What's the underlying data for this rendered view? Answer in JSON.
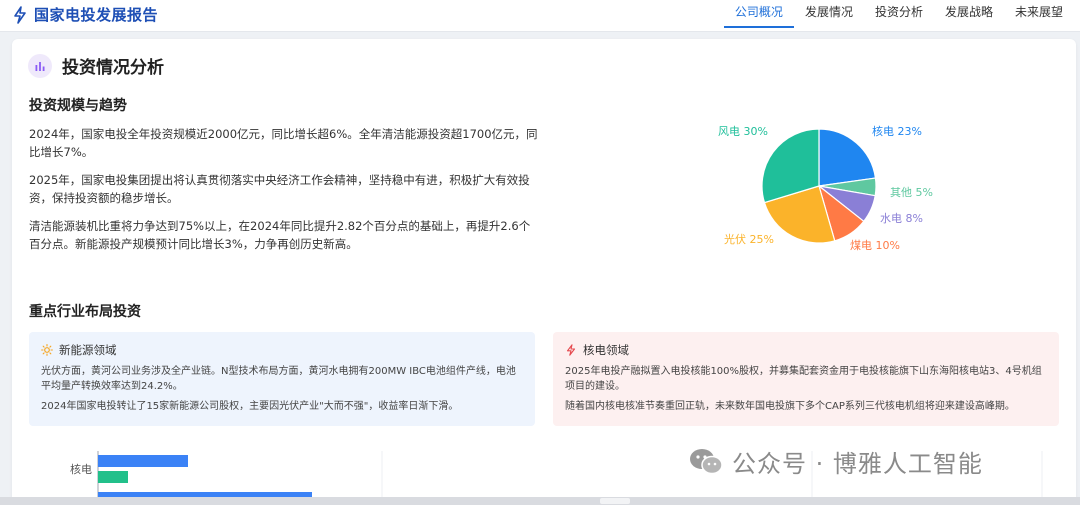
{
  "header": {
    "title": "国家电投发展报告",
    "nav": [
      {
        "label": "公司概况",
        "active": true
      },
      {
        "label": "发展情况",
        "active": false
      },
      {
        "label": "投资分析",
        "active": false
      },
      {
        "label": "发展战略",
        "active": false
      },
      {
        "label": "未来展望",
        "active": false
      }
    ]
  },
  "section": {
    "title": "投资情况分析"
  },
  "scale": {
    "title": "投资规模与趋势",
    "paragraphs": [
      "2024年，国家电投全年投资规模近2000亿元，同比增长超6%。全年清洁能源投资超1700亿元，同比增长7%。",
      "2025年，国家电投集团提出将认真贯彻落实中央经济工作会精神，坚持稳中有进，积极扩大有效投资，保持投资额的稳步增长。",
      "清洁能源装机比重将力争达到75%以上，在2024年同比提升2.82个百分点的基础上，再提升2.6个百分点。新能源投产规模预计同比增长3%，力争再创历史新高。"
    ]
  },
  "chart_data": [
    {
      "type": "pie",
      "slices": [
        {
          "name": "核电",
          "value": 23,
          "label": "核电 23%",
          "color": "#1f86f0"
        },
        {
          "name": "其他",
          "value": 5,
          "label": "其他 5%",
          "color": "#5fc8a0"
        },
        {
          "name": "水电",
          "value": 8,
          "label": "水电 8%",
          "color": "#8a7fd6"
        },
        {
          "name": "煤电",
          "value": 10,
          "label": "煤电 10%",
          "color": "#ff7a45"
        },
        {
          "name": "光伏",
          "value": 25,
          "label": "光伏 25%",
          "color": "#fbb32a"
        },
        {
          "name": "风电",
          "value": 30,
          "label": "风电 30%",
          "color": "#1fbf9a"
        }
      ]
    },
    {
      "type": "bar",
      "orientation": "horizontal",
      "categories": [
        "核电"
      ],
      "series": [
        {
          "values": [
            90
          ],
          "color": "#3b82f6"
        },
        {
          "values": [
            30
          ],
          "color": "#22c08a"
        }
      ]
    }
  ],
  "industry": {
    "title": "重点行业布局投资",
    "new_energy": {
      "title": "新能源领域",
      "icon": "sun-icon",
      "color": "#f5a623",
      "texts": [
        "光伏方面，黄河公司业务涉及全产业链。N型技术布局方面，黄河水电拥有200MW IBC电池组件产线，电池平均量产转换效率达到24.2%。",
        "2024年国家电投转让了15家新能源公司股权，主要因光伏产业\"大而不强\"，收益率日渐下滑。"
      ]
    },
    "nuclear": {
      "title": "核电领域",
      "icon": "lightning-icon",
      "color": "#e5484d",
      "texts": [
        "2025年电投产融拟置入电投核能100%股权，并募集配套资金用于电投核能旗下山东海阳核电站3、4号机组项目的建设。",
        "随着国内核电核准节奏重回正轨，未来数年国电投旗下多个CAP系列三代核电机组将迎来建设高峰期。"
      ]
    }
  },
  "watermark": {
    "text": "公众号 · 博雅人工智能"
  },
  "colors": {
    "brand": "#1e4fb5",
    "accent": "#1e6fd9"
  }
}
